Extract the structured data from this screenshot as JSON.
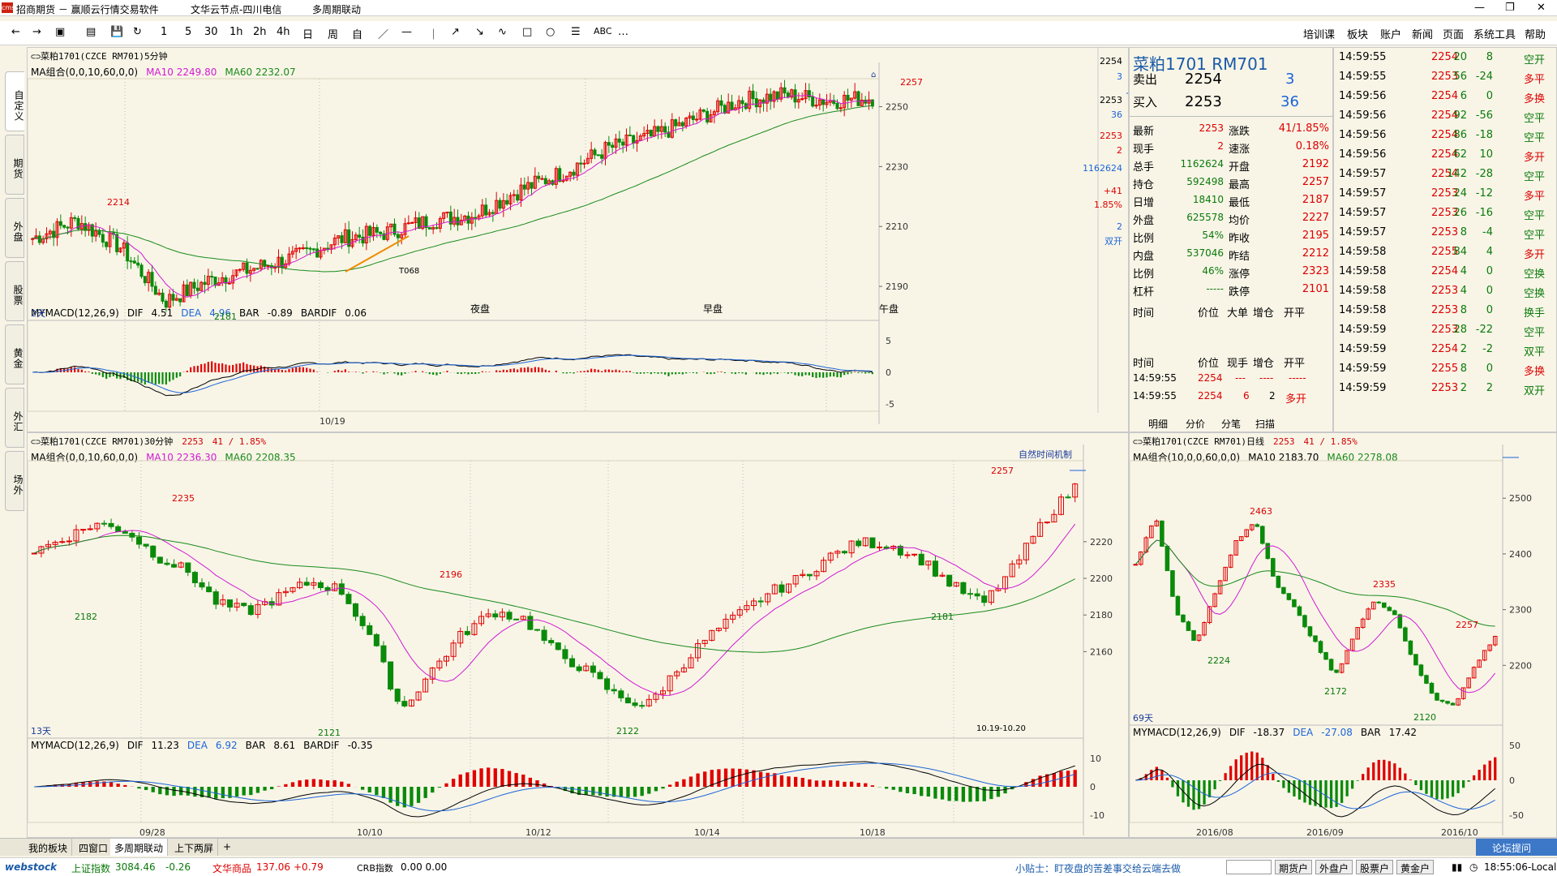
{
  "window": {
    "title": "招商期货 － 赢顺云行情交易软件",
    "server": "文华云节点-四川电信",
    "mode": "多周期联动",
    "logo": "cms",
    "controls": [
      "—",
      "❐",
      "✕"
    ]
  },
  "toolbar": {
    "tools": [
      "←",
      "→",
      "▣",
      "▤",
      "💾",
      "↻",
      "1",
      "5",
      "30",
      "1h",
      "2h",
      "4h",
      "日",
      "周",
      "自",
      "／",
      "—",
      "｜",
      "↗",
      "↘",
      "∿",
      "□",
      "○",
      "☰",
      "ABC",
      "…"
    ],
    "menu": [
      "培训课",
      "板块",
      "账户",
      "新闻",
      "页面",
      "系统工具",
      "帮助"
    ]
  },
  "left_tabs": [
    "自定义",
    "期货",
    "外盘",
    "股票",
    "黄金",
    "外汇",
    "场外"
  ],
  "panel_5m": {
    "header": "菜粕1701(CZCE RM701)5分钟",
    "ma": {
      "label": "MA组合(0,0,10,60,0,0)",
      "ma10": "MA10 2249.80",
      "ma60": "MA60 2232.07"
    },
    "days": "2天",
    "sessions": [
      "夜盘",
      "早盘",
      "午盘"
    ],
    "date": "10/19",
    "high_label": "2257",
    "high2": "2214",
    "low_label": "2181",
    "order": "T068",
    "yticks": [
      "2250",
      "2230",
      "2210",
      "2190"
    ],
    "side": {
      "sell": "2254",
      "sell_v": "3",
      "buy": "2253",
      "buy_v": "36",
      "last": "2253",
      "now": "2",
      "total": "1162624",
      "chg": "+41",
      "pct": "1.85%",
      "hand": "2",
      "kind": "双开"
    },
    "macd": {
      "label": "MYMACD(12,26,9)",
      "dif": "DIF",
      "dif_v": "4.51",
      "dea": "DEA",
      "dea_v": "4.96",
      "bar": "BAR",
      "bar_v": "-0.89",
      "bardif": "BARDIF",
      "bardif_v": "0.06",
      "yticks": [
        "5",
        "0",
        "-5"
      ]
    }
  },
  "panel_30m": {
    "header": "菜粕1701(CZCE RM701)30分钟",
    "last": "2253",
    "chg": "41 / 1.85%",
    "ma": {
      "label": "MA组合(0,0,10,60,0,0)",
      "ma10": "MA10 2236.30",
      "ma60": "MA60 2208.35"
    },
    "days": "13天",
    "note": "自然时间机制",
    "range": "10.19-10.20",
    "labels": [
      "2235",
      "2182",
      "2196",
      "2121",
      "2122",
      "2181",
      "2257"
    ],
    "yticks": [
      "2220",
      "2200",
      "2180",
      "2160"
    ],
    "dates": [
      "09/28",
      "10/10",
      "10/12",
      "10/14",
      "10/18"
    ],
    "macd": {
      "label": "MYMACD(12,26,9)",
      "dif": "DIF",
      "dif_v": "11.23",
      "dea": "DEA",
      "dea_v": "6.92",
      "bar": "BAR",
      "bar_v": "8.61",
      "bardif": "BARDIF",
      "bardif_v": "-0.35",
      "yticks": [
        "10",
        "0",
        "-10"
      ]
    }
  },
  "panel_day": {
    "header": "菜粕1701(CZCE RM701)日线",
    "last": "2253",
    "chg": "41 / 1.85%",
    "ma": {
      "label": "MA组合(10,0,0,60,0,0)",
      "ma10": "MA10 2183.70",
      "ma60": "MA60 2278.08"
    },
    "days": "69天",
    "labels": [
      "2463",
      "2224",
      "2335",
      "2172",
      "2120",
      "2257"
    ],
    "yticks": [
      "2500",
      "2400",
      "2300",
      "2200"
    ],
    "dates": [
      "2016/08",
      "2016/09",
      "2016/10"
    ],
    "macd": {
      "label": "MYMACD(12,26,9)",
      "dif": "DIF",
      "dif_v": "-18.37",
      "dea": "DEA",
      "dea_v": "-27.08",
      "bar": "BAR",
      "bar_v": "17.42",
      "yticks": [
        "50",
        "0",
        "-50"
      ]
    }
  },
  "quote": {
    "name": "菜粕1701 RM701",
    "sell_l": "卖出",
    "sell": "2254",
    "sell_v": "3",
    "buy_l": "买入",
    "buy": "2253",
    "buy_v": "36",
    "rows": [
      [
        "最新",
        "2253",
        "涨跌",
        "41/1.85%"
      ],
      [
        "现手",
        "2",
        "速涨",
        "0.18%"
      ],
      [
        "总手",
        "1162624",
        "开盘",
        "2192"
      ],
      [
        "持仓",
        "592498",
        "最高",
        "2257"
      ],
      [
        "日增",
        "18410",
        "最低",
        "2187"
      ],
      [
        "外盘",
        "625578",
        "均价",
        "2227"
      ],
      [
        "比例",
        "54%",
        "昨收",
        "2195"
      ],
      [
        "内盘",
        "537046",
        "昨结",
        "2212"
      ],
      [
        "比例",
        "46%",
        "涨停",
        "2323"
      ],
      [
        "杠杆",
        "-----",
        "跌停",
        "2101"
      ]
    ],
    "hdr1": [
      "时间",
      "价位",
      "大单",
      "增仓",
      "开平"
    ],
    "hdr2": [
      "时间",
      "价位",
      "现手",
      "增仓",
      "开平"
    ],
    "fills": [
      [
        "14:59:55",
        "2254",
        "---",
        "----",
        "-----"
      ],
      [
        "14:59:55",
        "2254",
        "6",
        "2",
        "多开"
      ]
    ],
    "tabs": [
      "明细",
      "分价",
      "分笔",
      "扫描"
    ]
  },
  "ticks": [
    [
      "14:59:55",
      "2254",
      "20",
      "8",
      "空开"
    ],
    [
      "14:59:55",
      "2253",
      "56",
      "-24",
      "多平"
    ],
    [
      "14:59:56",
      "2254",
      "6",
      "0",
      "多换"
    ],
    [
      "14:59:56",
      "2254",
      "92",
      "-56",
      "空平"
    ],
    [
      "14:59:56",
      "2254",
      "86",
      "-18",
      "空平"
    ],
    [
      "14:59:56",
      "2254",
      "62",
      "10",
      "多开"
    ],
    [
      "14:59:57",
      "2254",
      "142",
      "-28",
      "空平"
    ],
    [
      "14:59:57",
      "2253",
      "24",
      "-12",
      "多平"
    ],
    [
      "14:59:57",
      "2253",
      "26",
      "-16",
      "空平"
    ],
    [
      "14:59:57",
      "2253",
      "8",
      "-4",
      "空平"
    ],
    [
      "14:59:58",
      "2255",
      "84",
      "4",
      "多开"
    ],
    [
      "14:59:58",
      "2254",
      "4",
      "0",
      "空换"
    ],
    [
      "14:59:58",
      "2253",
      "4",
      "0",
      "空换"
    ],
    [
      "14:59:58",
      "2253",
      "8",
      "0",
      "换手"
    ],
    [
      "14:59:59",
      "2253",
      "28",
      "-22",
      "空平"
    ],
    [
      "14:59:59",
      "2254",
      "2",
      "-2",
      "双平"
    ],
    [
      "14:59:59",
      "2255",
      "8",
      "0",
      "多换"
    ],
    [
      "14:59:59",
      "2253",
      "2",
      "2",
      "双开"
    ]
  ],
  "bottom_tabs": [
    "我的板块",
    "四窗口",
    "多周期联动",
    "上下两屏",
    "+"
  ],
  "forum": "论坛提问",
  "status": {
    "brand": "webstock",
    "sh_l": "上证指数",
    "sh_v": "3084.46",
    "sh_c": "-0.26",
    "wh_l": "文华商品",
    "wh_v": "137.06",
    "wh_c": "+0.79",
    "crb_l": "CRB指数",
    "crb_v": "0.00 0.00",
    "tip": "小贴士：盯夜盘的苦差事交给云端去做",
    "btns": [
      "期货户",
      "外盘户",
      "股票户",
      "黄金户"
    ],
    "time": "18:55:06-Local"
  },
  "colors": {
    "up": "#e00000",
    "down": "#0a8a0a",
    "ma10": "#d11ad1",
    "ma60": "#1a8a1a",
    "dif": "#000000",
    "dea": "#1d64d8"
  }
}
